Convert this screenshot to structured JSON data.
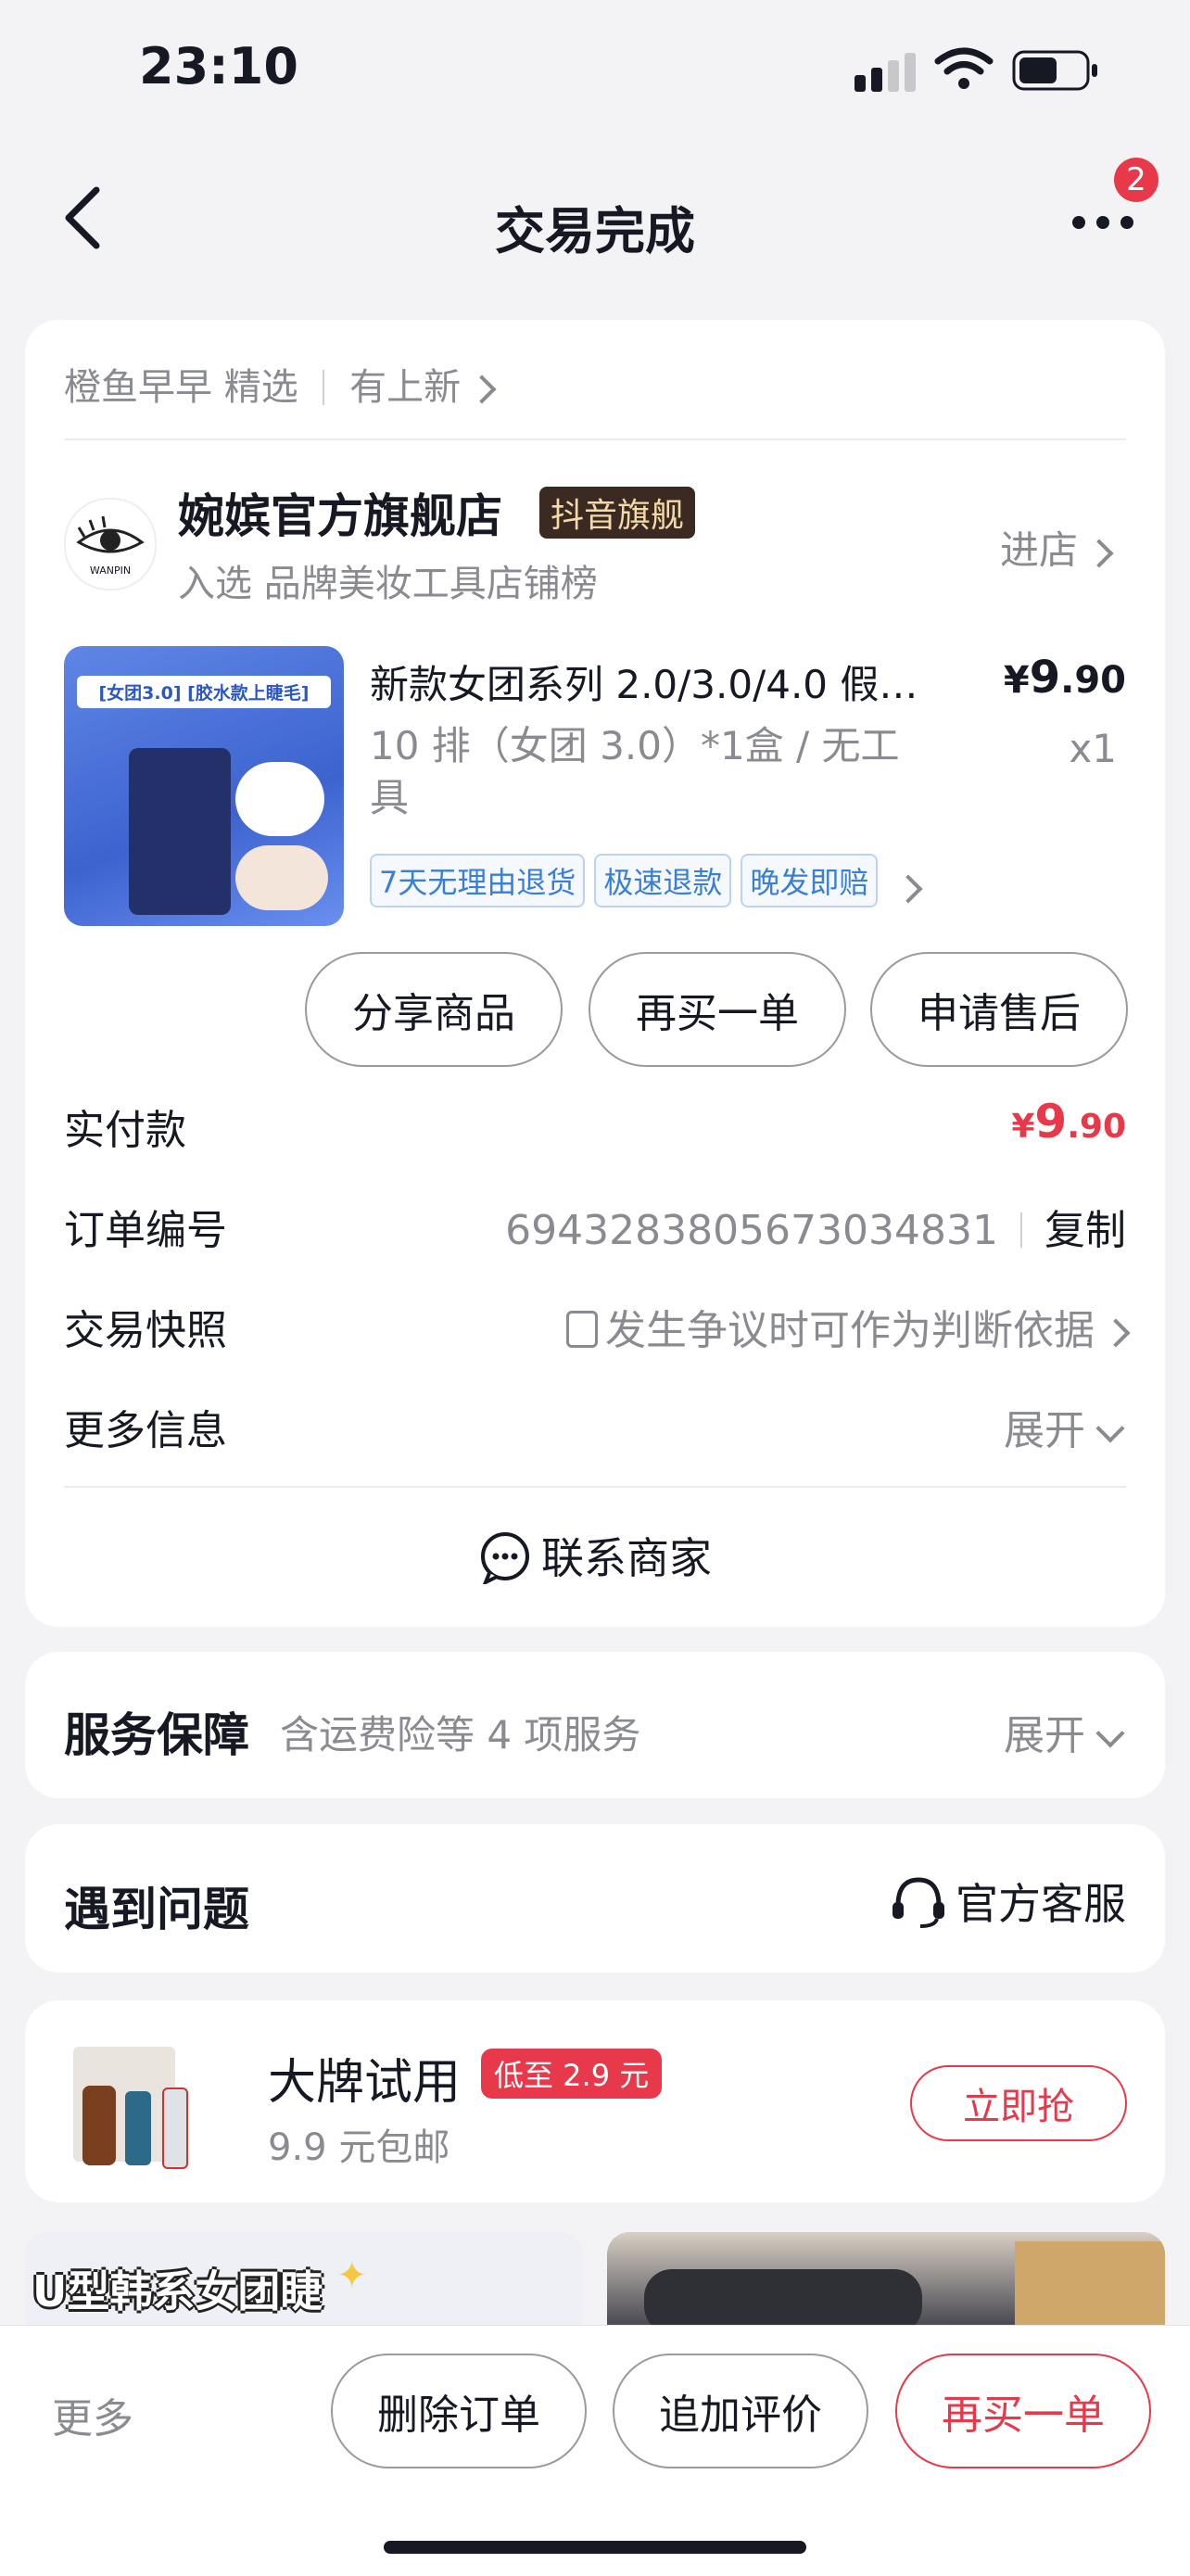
{
  "status_bar": {
    "time": "23:10"
  },
  "header": {
    "title": "交易完成",
    "badge": "2"
  },
  "recommend_bar": {
    "shop": "橙鱼早早 精选",
    "link": "有上新"
  },
  "shop": {
    "name": "婉嫔官方旗舰店",
    "badge": "抖音旗舰",
    "ranking": "入选 品牌美妆工具店铺榜",
    "enter": "进店",
    "logo_text": "WANPIN"
  },
  "product": {
    "title": "新款女团系列 2.0/3.0/4.0 假…",
    "spec": "10 排（女团 3.0）*1盒 / 无工具",
    "price_symbol": "¥",
    "price_int": "9",
    "price_dec": ".90",
    "qty": "x1",
    "tags": [
      "7天无理由退货",
      "极速退款",
      "晚发即赔"
    ],
    "thumb_caption": "[女团3.0] [胶水款上睫毛]"
  },
  "actions": {
    "share": "分享商品",
    "rebuy": "再买一单",
    "after_sale": "申请售后"
  },
  "payment": {
    "label": "实付款",
    "symbol": "¥",
    "int": "9",
    "dec": ".90"
  },
  "order": {
    "label": "订单编号",
    "number": "6943283805673034831",
    "copy": "复制"
  },
  "snapshot": {
    "label": "交易快照",
    "value": "发生争议时可作为判断依据"
  },
  "more_info": {
    "label": "更多信息",
    "value": "展开"
  },
  "contact": {
    "label": "联系商家"
  },
  "service": {
    "title": "服务保障",
    "desc": "含运费险等 4 项服务",
    "expand": "展开"
  },
  "issue": {
    "title": "遇到问题",
    "support": "官方客服"
  },
  "promo": {
    "title": "大牌试用",
    "badge": "低至 2.9 元",
    "sub": "9.9 元包邮",
    "cta": "立即抢"
  },
  "feed": {
    "left_caption": "U型韩系女团睫"
  },
  "bottom_bar": {
    "more": "更多",
    "delete": "删除订单",
    "review": "追加评价",
    "rebuy": "再买一单"
  },
  "colors": {
    "accent": "#e8394b",
    "background": "#f3f3f5",
    "tag_blue": "#3a7fd6"
  }
}
